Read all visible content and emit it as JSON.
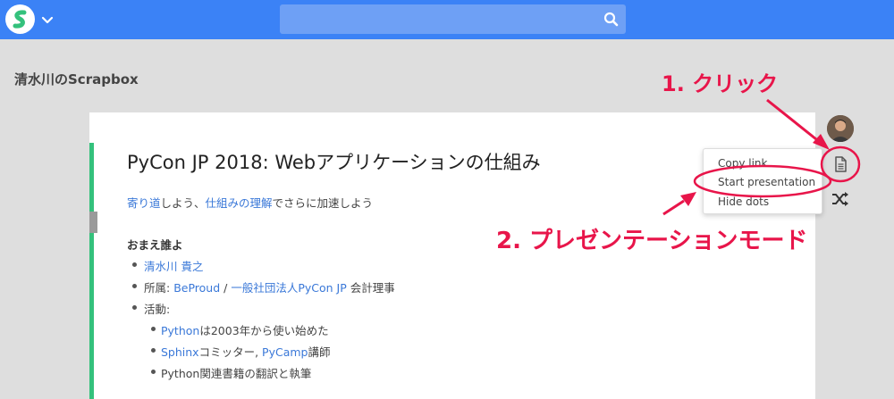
{
  "navbar": {
    "search": {
      "placeholder": ""
    },
    "search_icon": "search-icon",
    "logo_icon": "scrapbox-logo",
    "chevron_icon": "chevron-down-icon"
  },
  "project": {
    "title": "清水川のScrapbox"
  },
  "page": {
    "title": "PyCon JP 2018: Webアプリケーションの仕組み",
    "intro": {
      "link1": "寄り道",
      "text1": "しよう、",
      "link2": "仕組みの理解",
      "text2": "でさらに加速しよう"
    },
    "section_heading": "おまえ誰よ",
    "items": {
      "name": "清水川 貴之",
      "affiliation_label": "所属: ",
      "affiliation_link1": "BeProud",
      "affiliation_sep": " / ",
      "affiliation_link2": "一般社団法人PyCon JP",
      "affiliation_suffix": " 会計理事",
      "activity_label": "活動:",
      "sub1_link": "Python",
      "sub1_text": "は2003年から使い始めた",
      "sub2_link1": "Sphinx",
      "sub2_text1": "コミッター, ",
      "sub2_link2": "PyCamp",
      "sub2_text2": "講師",
      "sub3_text": "Python関連書籍の翻訳と執筆"
    }
  },
  "dropdown": {
    "copy_link": "Copy link",
    "start_presentation": "Start presentation",
    "hide_dots": "Hide dots"
  },
  "annotations": {
    "step1": "1. クリック",
    "step2": "2. プレゼンテーションモード",
    "color": "#e8154a"
  },
  "colors": {
    "navbar": "#3b82f6",
    "link": "#3a78d8",
    "accent_bar": "#34c17c"
  }
}
